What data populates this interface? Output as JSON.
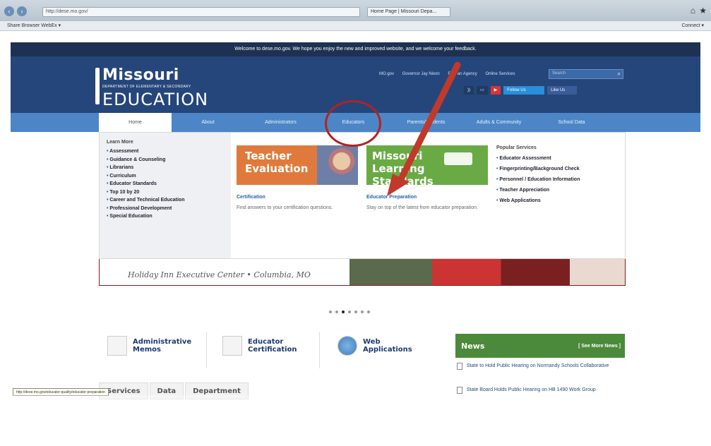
{
  "browser": {
    "url": "http://dese.mo.gov/",
    "tab_title": "Home Page | Missouri Depa...",
    "favorites": "Share Browser   WebEx ▾",
    "favorites_right": "Connect ▾"
  },
  "site": {
    "welcome": "Welcome to dese.mo.gov. We hope you enjoy the new and improved website, and we welcome your feedback.",
    "logo": {
      "line1": "Missouri",
      "line2": "DEPARTMENT OF ELEMENTARY & SECONDARY",
      "line3": "EDUCATION"
    },
    "toplinks": [
      "MO.gov",
      "Governor Jay Nixon",
      "Find an Agency",
      "Online Services"
    ],
    "search_placeholder": "Search",
    "social": {
      "follow": "Follow Us",
      "like": "Like Us"
    },
    "nav": [
      "Home",
      "About",
      "Administrators",
      "Educators",
      "Parents/Students",
      "Adults & Community",
      "School Data"
    ]
  },
  "mega": {
    "learn_title": "Learn More",
    "learn_items": [
      "Assessment",
      "Guidance & Counseling",
      "Librarians",
      "Curriculum",
      "Educator Standards",
      "Top 10 by 20",
      "Career and Technical Education",
      "Professional Development",
      "Special Education"
    ],
    "promo1": {
      "line1": "Teacher",
      "line2": "Evaluation",
      "title": "Certification",
      "desc": "Find answers to your certification questions."
    },
    "promo2": {
      "line1": "Missouri",
      "line2": "Learning Standards",
      "title": "Educator Preparation",
      "desc": "Stay on top of the latest from educator preparation."
    },
    "popular_title": "Popular Services",
    "popular_items": [
      "Educator Assessment",
      "Fingerprinting/Background Check",
      "Personnel / Education Information",
      "Teacher Appreciation",
      "Web Applications"
    ]
  },
  "banner": {
    "venue": "Holiday Inn Executive Center • Columbia, MO"
  },
  "quicklinks": [
    {
      "l1": "Administrative",
      "l2": "Memos"
    },
    {
      "l1": "Educator",
      "l2": "Certification"
    },
    {
      "l1": "Web",
      "l2": "Applications"
    }
  ],
  "news": {
    "title": "News",
    "more": "[ See More News ]",
    "items": [
      "State to Hold Public Hearing on Normandy Schools Collaborative",
      "State Board Holds Public Hearing on HB 1490 Work Group"
    ]
  },
  "tabs": [
    "Services",
    "Data",
    "Department"
  ],
  "tooltip": "http://dese.mo.gov/educator-quality/educator-preparation"
}
